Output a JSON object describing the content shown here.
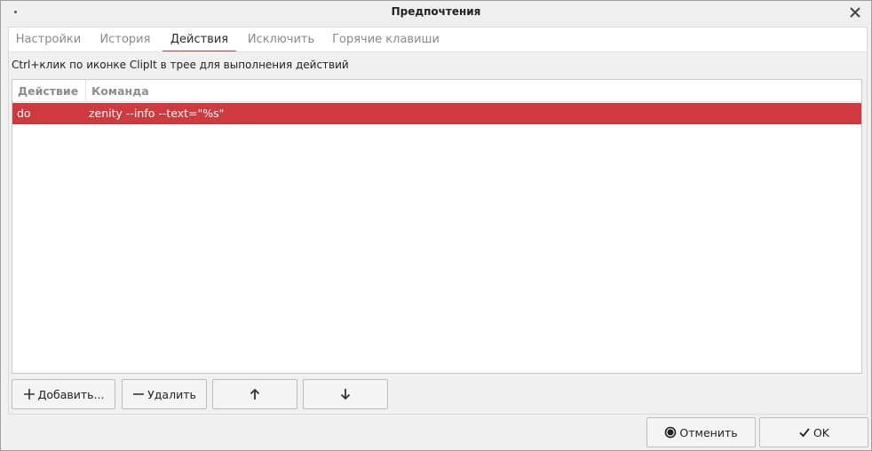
{
  "window": {
    "title": "Предпочтения"
  },
  "tabs": [
    {
      "label": "Настройки"
    },
    {
      "label": "История"
    },
    {
      "label": "Действия"
    },
    {
      "label": "Исключить"
    },
    {
      "label": "Горячие клавиши"
    }
  ],
  "active_tab": "Действия",
  "actions_page": {
    "hint": "Ctrl+клик по иконке ClipIt в трее для выполнения действий",
    "columns": [
      {
        "label": "Действие"
      },
      {
        "label": "Команда"
      }
    ],
    "rows": [
      {
        "action": "do",
        "command": "zenity --info --text=\"%s\"",
        "selected": true
      }
    ],
    "buttons": {
      "add_label": "Добавить...",
      "remove_label": "Удалить",
      "up_icon": "arrow-up-icon",
      "down_icon": "arrow-down-icon"
    }
  },
  "dialog_buttons": {
    "cancel_label": "Отменить",
    "ok_label": "OK"
  },
  "colors": {
    "accent": "#cf3a3e",
    "selection_text": "#ffffff",
    "background": "#f0f0f0",
    "header_text": "#8c8c8c"
  }
}
